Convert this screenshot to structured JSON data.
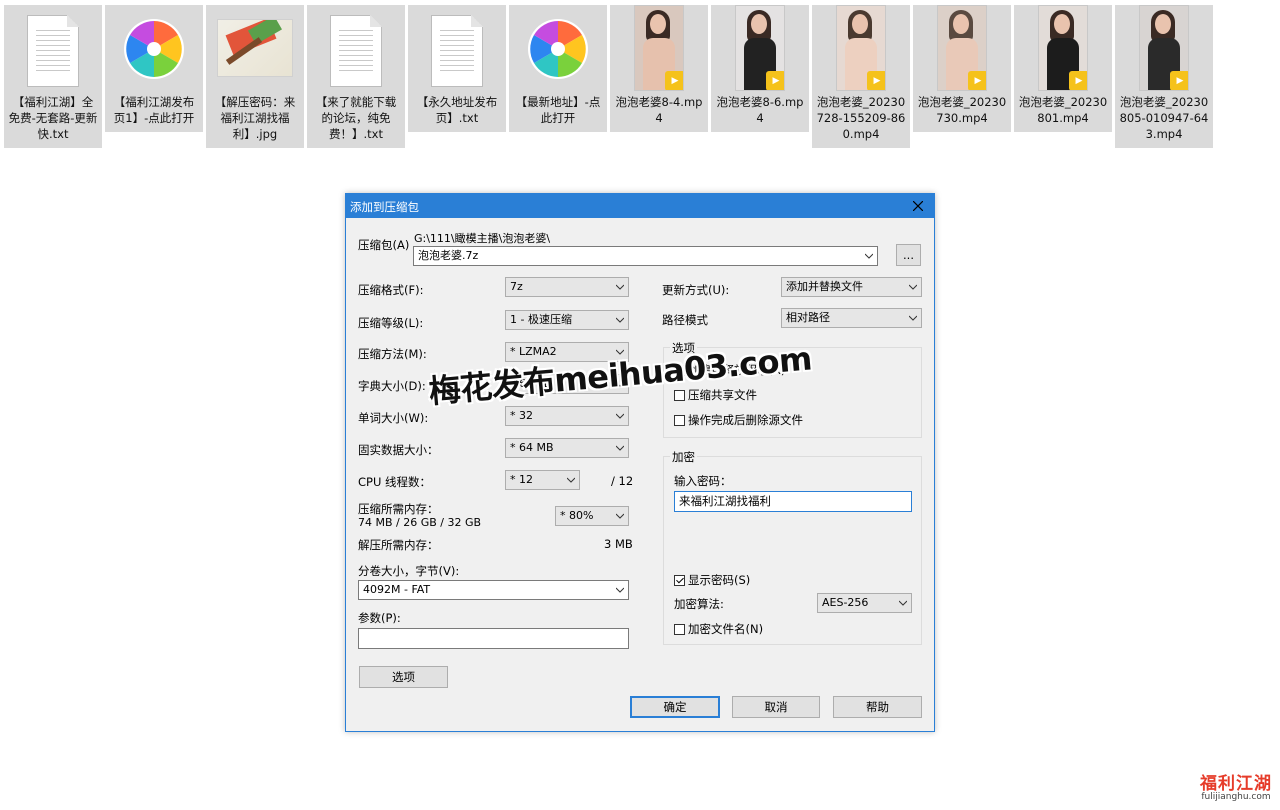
{
  "files": [
    {
      "name": "【福利江湖】全免费-无套路-更新快.txt",
      "icon": "text-file-icon"
    },
    {
      "name": "【福利江湖发布页1】-点此打开",
      "icon": "pinwheel-shortcut-icon"
    },
    {
      "name": "【解压密码：来福利江湖找福利】.jpg",
      "icon": "image-file-icon"
    },
    {
      "name": "【来了就能下载的论坛，纯免费！】.txt",
      "icon": "text-file-icon"
    },
    {
      "name": "【永久地址发布页】.txt",
      "icon": "text-file-icon"
    },
    {
      "name": "【最新地址】-点此打开",
      "icon": "pinwheel-shortcut-icon"
    },
    {
      "name": "泡泡老婆8-4.mp4",
      "icon": "video-file-icon"
    },
    {
      "name": "泡泡老婆8-6.mp4",
      "icon": "video-file-icon"
    },
    {
      "name": "泡泡老婆_20230728-155209-860.mp4",
      "icon": "video-file-icon"
    },
    {
      "name": "泡泡老婆_20230730.mp4",
      "icon": "video-file-icon"
    },
    {
      "name": "泡泡老婆_20230801.mp4",
      "icon": "video-file-icon"
    },
    {
      "name": "泡泡老婆_20230805-010947-643.mp4",
      "icon": "video-file-icon"
    }
  ],
  "dialog": {
    "title": "添加到压缩包",
    "archive_label": "压缩包(A)",
    "archive_path": "G:\\111\\瞰模主播\\泡泡老婆\\",
    "archive_name": "泡泡老婆.7z",
    "browse_label": "...",
    "format_label": "压缩格式(F):",
    "format_value": "7z",
    "level_label": "压缩等级(L):",
    "level_value": "1 - 极速压缩",
    "method_label": "压缩方法(M):",
    "method_value": "* LZMA2",
    "dict_label": "字典大小(D):",
    "dict_value": "* 64 KB",
    "word_label": "单词大小(W):",
    "word_value": "* 32",
    "solid_label": "固实数据大小：",
    "solid_value": "* 64 MB",
    "cpu_label": "CPU 线程数：",
    "cpu_value": "* 12",
    "cpu_total": "/ 12",
    "mem_label": "压缩所需内存：",
    "mem_detail": "74 MB / 26 GB / 32 GB",
    "mem_value": "* 80%",
    "decomp_label": "解压所需内存：",
    "decomp_value": "3 MB",
    "split_label": "分卷大小，字节(V):",
    "split_value": "4092M - FAT",
    "params_label": "参数(P):",
    "params_value": "",
    "options_button": "选项",
    "update_label": "更新方式(U):",
    "update_value": "添加并替换文件",
    "pathmode_label": "路径模式",
    "pathmode_value": "相对路径",
    "options_group": "选项",
    "opt_sfx": "创建自释放程序(X)",
    "opt_shared": "压缩共享文件",
    "opt_delete": "操作完成后删除源文件",
    "encrypt_group": "加密",
    "password_label": "输入密码：",
    "password_value": "来福利江湖找福利",
    "show_password": "显示密码(S)",
    "algo_label": "加密算法:",
    "algo_value": "AES-256",
    "encrypt_names": "加密文件名(N)",
    "ok": "确定",
    "cancel": "取消",
    "help": "帮助"
  },
  "watermark": "梅花发布meihua03.com",
  "corner_logo": {
    "text": "福利江湖",
    "url": "fulijianghu.com"
  }
}
